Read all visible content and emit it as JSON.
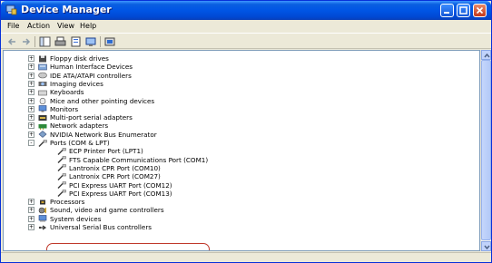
{
  "window": {
    "title": "Device Manager"
  },
  "menu": [
    "File",
    "Action",
    "View",
    "Help"
  ],
  "colors": {
    "titlebar": "#0055e5",
    "highlight_ring": "#c0392b"
  },
  "tree": {
    "categories": [
      {
        "label": "Floppy disk drives",
        "icon": "floppy-icon"
      },
      {
        "label": "Human Interface Devices",
        "icon": "hid-icon"
      },
      {
        "label": "IDE ATA/ATAPI controllers",
        "icon": "ide-icon"
      },
      {
        "label": "Imaging devices",
        "icon": "camera-icon"
      },
      {
        "label": "Keyboards",
        "icon": "keyboard-icon"
      },
      {
        "label": "Mice and other pointing devices",
        "icon": "mouse-icon"
      },
      {
        "label": "Monitors",
        "icon": "monitor-icon"
      },
      {
        "label": "Multi-port serial adapters",
        "icon": "serial-adapter-icon"
      },
      {
        "label": "Network adapters",
        "icon": "network-icon"
      },
      {
        "label": "NVIDIA Network Bus Enumerator",
        "icon": "nvidia-icon"
      },
      {
        "label": "Ports (COM & LPT)",
        "icon": "port-icon"
      }
    ],
    "ports": [
      "ECP Printer Port (LPT1)",
      "FTS Capable Communications Port (COM1)",
      "Lantronix CPR Port (COM10)",
      "Lantronix CPR Port (COM27)",
      "PCI Express UART Port (COM12)",
      "PCI Express UART Port (COM13)"
    ],
    "after": [
      {
        "label": "Processors",
        "icon": "processor-icon"
      },
      {
        "label": "Sound, video and game controllers",
        "icon": "sound-icon"
      },
      {
        "label": "System devices",
        "icon": "system-icon"
      },
      {
        "label": "Universal Serial Bus controllers",
        "icon": "usb-icon"
      }
    ]
  }
}
